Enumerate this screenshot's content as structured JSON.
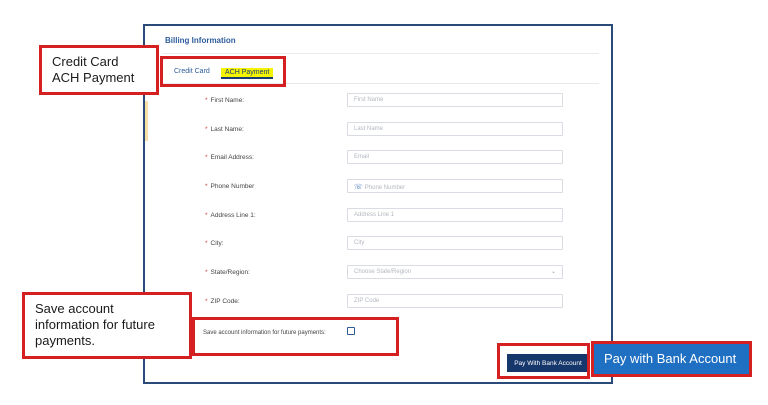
{
  "billing": {
    "title": "Billing Information",
    "tabs": [
      {
        "label": "Credit Card"
      },
      {
        "label": "ACH Payment"
      }
    ],
    "fields": [
      {
        "label": "First Name:",
        "placeholder": "First Name"
      },
      {
        "label": "Last Name:",
        "placeholder": "Last Name"
      },
      {
        "label": "Email Address:",
        "placeholder": "Email"
      },
      {
        "label": "Phone Number",
        "placeholder": "Phone Number"
      },
      {
        "label": "Address Line 1:",
        "placeholder": "Address Line 1"
      },
      {
        "label": "City:",
        "placeholder": "City"
      },
      {
        "label": "State/Region:",
        "placeholder": "Choose State/Region"
      },
      {
        "label": "ZIP Code:",
        "placeholder": "ZIP Code"
      }
    ],
    "required_mark": "*",
    "save_label": "Save account information for future payments:",
    "pay_button": "Pay With Bank Account"
  },
  "callouts": {
    "tabs_note_line1": "Credit Card",
    "tabs_note_line2": "ACH Payment",
    "save_note": "Save account information for future payments.",
    "pay_note": "Pay with Bank Account"
  },
  "colors": {
    "accent": "#2e5c9a",
    "highlight": "#f4f400",
    "callout_border": "#d42020",
    "callout_blue": "#1f6fc2",
    "button": "#16376b"
  },
  "icons": {
    "phone": "phone-icon",
    "dropdown": "chevron-down-icon"
  }
}
